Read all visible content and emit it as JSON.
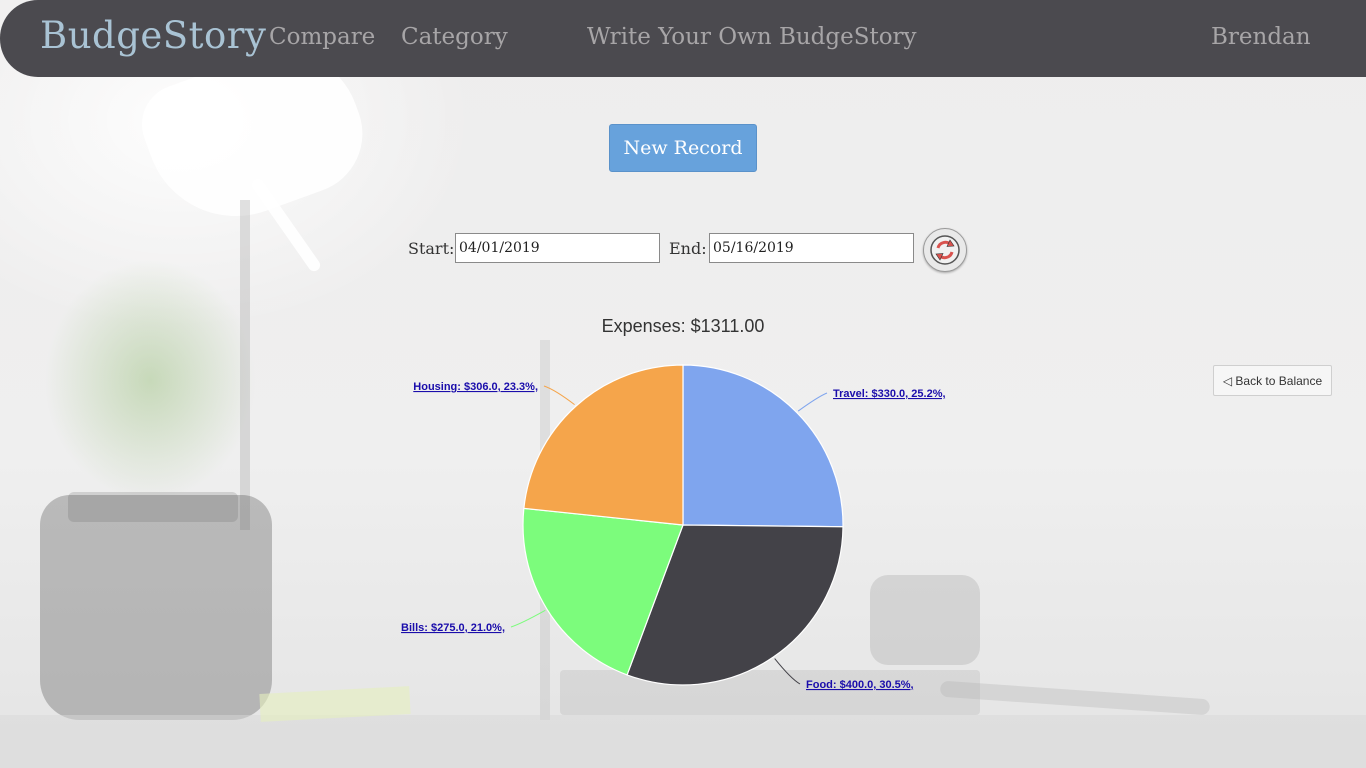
{
  "header": {
    "brand": "BudgeStory",
    "nav": {
      "compare": "Compare",
      "category": "Category",
      "write": "Write Your Own BudgeStory",
      "user": "Brendan"
    }
  },
  "main": {
    "new_record_label": "New Record",
    "date_range": {
      "start_label": "Start:",
      "start_value": "04/01/2019",
      "end_label": "End:",
      "end_value": "05/16/2019"
    },
    "refresh_icon": "refresh-icon",
    "back_label": "◁ Back to Balance"
  },
  "chart_data": {
    "type": "pie",
    "title": "Expenses: $1311.00",
    "slices": [
      {
        "label": "Travel: $330.0, 25.2%,",
        "name": "Travel",
        "value": 330.0,
        "percent": 25.2,
        "color": "#7fa5ee"
      },
      {
        "label": "Food: $400.0, 30.5%,",
        "name": "Food",
        "value": 400.0,
        "percent": 30.5,
        "color": "#434248"
      },
      {
        "label": "Bills: $275.0, 21.0%,",
        "name": "Bills",
        "value": 275.0,
        "percent": 21.0,
        "color": "#7cfc7c"
      },
      {
        "label": "Housing: $306.0, 23.3%,",
        "name": "Housing",
        "value": 306.0,
        "percent": 23.3,
        "color": "#f5a54b"
      }
    ]
  }
}
